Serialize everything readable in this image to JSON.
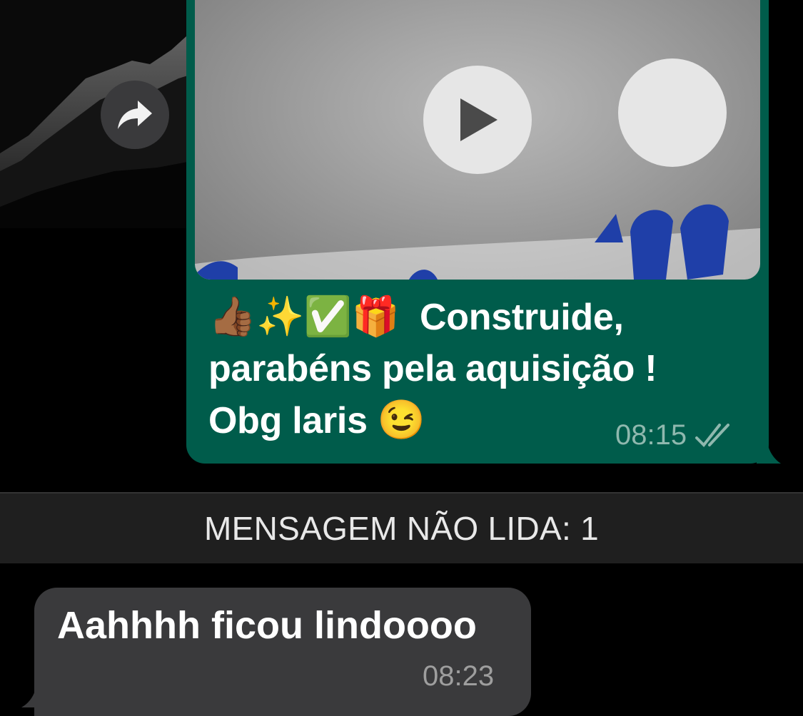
{
  "outgoing_message": {
    "text_line1": "Construide,",
    "text_line2": "parabéns pela aquisição !",
    "text_line3": "Obg laris",
    "emojis_line1": [
      "👍🏾",
      "✨",
      "✅",
      "🎁"
    ],
    "emoji_line3": "😉",
    "time": "08:15",
    "status_icon": "double-check-icon"
  },
  "video": {
    "play_icon": "play-icon"
  },
  "forward_icon": "forward-arrow-icon",
  "unread_banner": {
    "label": "MENSAGEM NÃO LIDA: 1"
  },
  "incoming_message": {
    "text": "Aahhhh ficou lindoooo",
    "time": "08:23"
  },
  "colors": {
    "outgoing_bubble": "#005c4b",
    "incoming_bubble": "#3a3a3c",
    "background": "#000000",
    "banner": "#1f1f1f"
  }
}
